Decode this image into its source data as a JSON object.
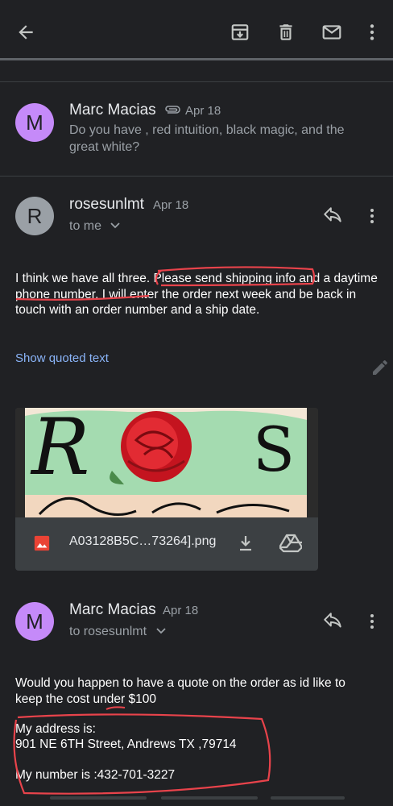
{
  "toolbar": {
    "back_icon": "arrow-back-icon",
    "archive_icon": "archive-icon",
    "delete_icon": "trash-icon",
    "mark_unread_icon": "mail-icon",
    "more_icon": "more-vert-icon"
  },
  "thread": {
    "collapsed_message": {
      "avatar_letter": "M",
      "sender": "Marc Macias",
      "date": "Apr 18",
      "snippet": "Do you have , red intuition, black magic, and the great white?",
      "has_attachment": true
    },
    "message_1": {
      "avatar_letter": "R",
      "sender": "rosesunlmt",
      "date": "Apr 18",
      "to": "to me",
      "body_part1": "I think we have all three.",
      "body_highlight1": "Please send shipping info",
      "body_and": " and a",
      "body_highlight2": "daytime phone number",
      "body_rest": ".  I will enter the order next week and be back in touch with an order number and a ship date.",
      "show_quoted": "Show quoted text",
      "attachment": {
        "name": "A03128B5C…73264].png",
        "type_icon": "image-icon",
        "download_icon": "download-icon",
        "drive_icon": "drive-icon"
      }
    },
    "message_2": {
      "avatar_letter": "M",
      "sender": "Marc Macias",
      "date": "Apr 18",
      "to": "to rosesunlmt",
      "body": "Would you happen to have a quote on the order as id like to keep the cost under $100",
      "address_label": "My address is:",
      "address": " 901 NE 6TH Street, Andrews TX ,79714",
      "number": "My number is :432-701-3227"
    }
  },
  "colors": {
    "background": "#202124",
    "link": "#8ab4f8",
    "avatar_purple": "#c58af9",
    "avatar_grey": "#9aa0a6",
    "annotation_red": "#e8434b"
  }
}
